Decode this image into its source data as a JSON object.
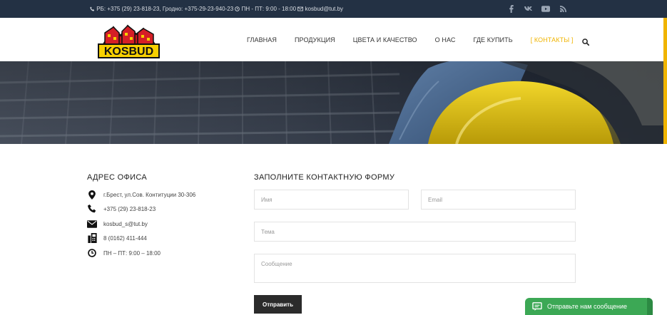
{
  "topbar": {
    "phones": "РБ: +375 (29) 23-818-23, Гродно: +375-29-23-940-23",
    "hours": "ПН - ПТ: 9:00 - 18:00",
    "email": "kosbud@tut.by",
    "social": [
      "facebook-icon",
      "vk-icon",
      "youtube-icon",
      "rss-icon"
    ]
  },
  "logo": {
    "text": "KOSBUD"
  },
  "nav": {
    "items": [
      {
        "label": "ГЛАВНАЯ"
      },
      {
        "label": "ПРОДУКЦИЯ"
      },
      {
        "label": "ЦВЕТА И КАЧЕСТВО"
      },
      {
        "label": "О НАС"
      },
      {
        "label": "ГДЕ КУПИТЬ"
      },
      {
        "label": "[ КОНТАКТЫ ]"
      }
    ]
  },
  "office": {
    "title": "АДРЕС ОФИСА",
    "items": [
      {
        "icon": "map-marker-icon",
        "text": "г.Брест, ул.Сов. Контитуции 30-306"
      },
      {
        "icon": "phone-icon",
        "text": "+375 (29) 23-818-23"
      },
      {
        "icon": "envelope-icon",
        "text": "kosbud_s@tut.by"
      },
      {
        "icon": "fax-icon",
        "text": "8 (0162) 411-444"
      },
      {
        "icon": "clock-icon",
        "text": "ПН – ПТ: 9:00 – 18:00"
      }
    ]
  },
  "form": {
    "title": "ЗАПОЛНИТЕ КОНТАКТНУЮ ФОРМУ",
    "name_placeholder": "Имя",
    "email_placeholder": "Email",
    "subject_placeholder": "Тема",
    "message_placeholder": "Сообщение",
    "submit_label": "Отправить"
  },
  "chat": {
    "label": "Отправьте нам сообщение"
  },
  "colors": {
    "accent": "#f0b400",
    "topbar": "#233144",
    "chat": "#3ca855"
  }
}
